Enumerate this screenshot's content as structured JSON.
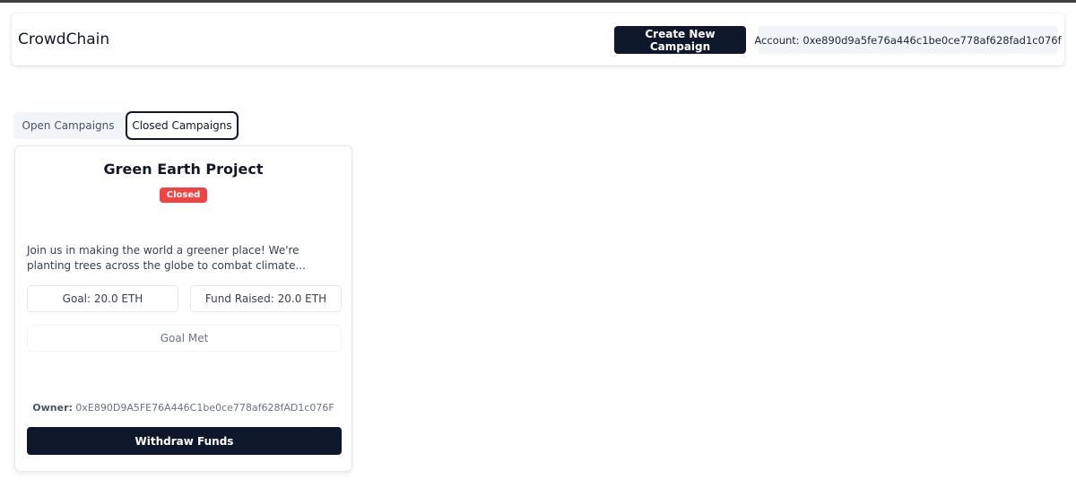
{
  "app": {
    "brand": "CrowdChain",
    "create_label": "Create New Campaign",
    "account_text": "Account: 0xe890d9a5fe76a446c1be0ce778af628fad1c076f"
  },
  "tabs": [
    {
      "label": "Open Campaigns",
      "active": false
    },
    {
      "label": "Closed Campaigns",
      "active": true
    }
  ],
  "campaign": {
    "title": "Green Earth Project",
    "status": "Closed",
    "description": "Join us in making the world a greener place! We're planting trees across the globe to combat climate...",
    "goal": "Goal: 20.0 ETH",
    "raised": "Fund Raised: 20.0 ETH",
    "goal_status": "Goal Met",
    "owner_label": "Owner:",
    "owner_address": "0xE890D9A5FE76A446C1be0ce778af628fAD1c076F",
    "withdraw_label": "Withdraw Funds"
  },
  "colors": {
    "primary": "#0f172a",
    "closed_badge": "#ef4444",
    "muted_bg": "#f1f5f9"
  }
}
